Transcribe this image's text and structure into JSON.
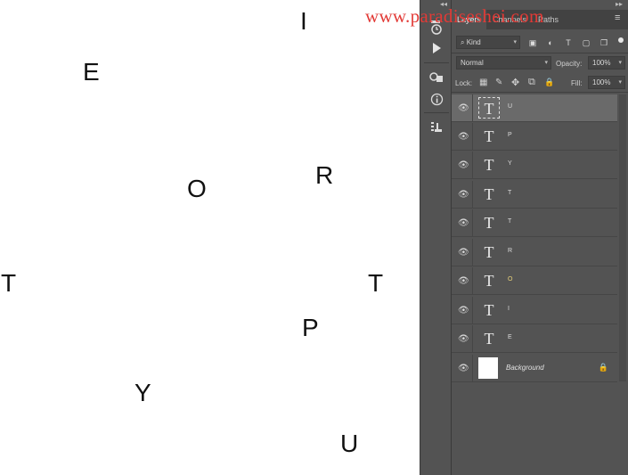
{
  "watermark": "www.paradiseshei.com",
  "canvas_letters": [
    "I",
    "E",
    "R",
    "O",
    "T",
    "T",
    "P",
    "Y",
    "U"
  ],
  "tools": {
    "collapse_left": "◂◂",
    "collapse_right": "▸▸",
    "icons": [
      "history-icon",
      "play-action-icon",
      "color-swatches-icon",
      "info-icon",
      "properties-icon"
    ]
  },
  "panel": {
    "tabs": [
      "Layers",
      "Channels",
      "Paths"
    ],
    "active_tab": "Layers",
    "menu_glyph": "≡",
    "filter": {
      "kind_label": "Kind",
      "kind_glyph": "⌕"
    },
    "filter_icons": {
      "pixel": "▣",
      "adjust": "◐",
      "type": "T",
      "shape": "▢",
      "smart": "❐"
    },
    "blend_mode": "Normal",
    "opacity_label": "Opacity:",
    "opacity_value": "100%",
    "lock_label": "Lock:",
    "lock_icons": {
      "pixels": "▦",
      "paint": "✎",
      "move": "✥",
      "artboard": "⧉",
      "all": "🔒"
    },
    "fill_label": "Fill:",
    "fill_value": "100%",
    "layers": [
      {
        "name": "U",
        "type": "text",
        "selected": true
      },
      {
        "name": "P",
        "type": "text"
      },
      {
        "name": "Y",
        "type": "text"
      },
      {
        "name": "T",
        "type": "text"
      },
      {
        "name": "T",
        "type": "text"
      },
      {
        "name": "R",
        "type": "text"
      },
      {
        "name": "O",
        "type": "text"
      },
      {
        "name": "I",
        "type": "text"
      },
      {
        "name": "E",
        "type": "text"
      },
      {
        "name": "Background",
        "type": "image",
        "locked": true
      }
    ],
    "text_thumb_glyph": "T",
    "eye_glyph": "👁",
    "lock_glyph": "🔒"
  }
}
